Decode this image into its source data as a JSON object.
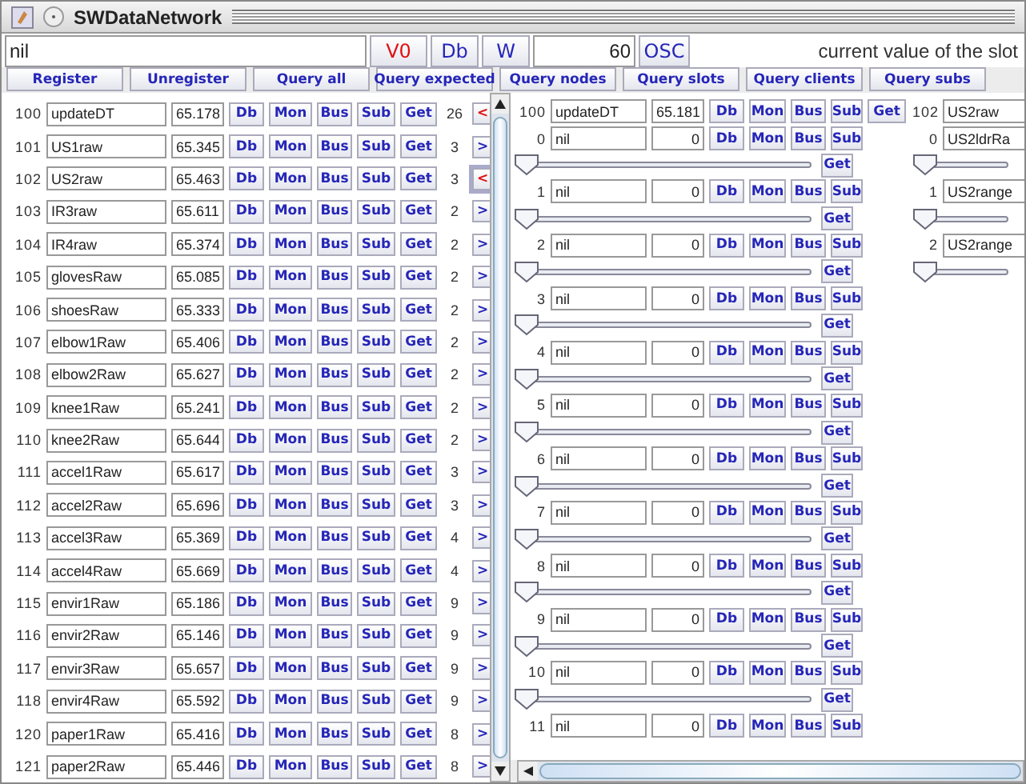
{
  "window": {
    "title": "SWDataNetwork"
  },
  "toolbar": {
    "input": "nil",
    "buttons": [
      {
        "label": "V0",
        "kind": "alert"
      },
      {
        "label": "Db",
        "kind": "normal"
      },
      {
        "label": "W",
        "kind": "normal"
      }
    ],
    "port": "60",
    "osc_button": "OSC",
    "status": "current value of the slot"
  },
  "queries": [
    "Register",
    "Unregister",
    "Query all",
    "Query expected",
    "Query nodes",
    "Query slots",
    "Query clients",
    "Query subs"
  ],
  "nodes": [
    {
      "id": "100",
      "name": "updateDT",
      "value": "65.178",
      "buttons": [
        "Db",
        "Mon",
        "Bus",
        "Sub",
        "Get"
      ],
      "count": "26",
      "arrow": "<",
      "kind": "back",
      "focused": false
    },
    {
      "id": "101",
      "name": "US1raw",
      "value": "65.345",
      "buttons": [
        "Db",
        "Mon",
        "Bus",
        "Sub",
        "Get"
      ],
      "count": "3",
      "arrow": ">",
      "kind": "forward",
      "focused": false
    },
    {
      "id": "102",
      "name": "US2raw",
      "value": "65.463",
      "buttons": [
        "Db",
        "Mon",
        "Bus",
        "Sub",
        "Get"
      ],
      "count": "3",
      "arrow": "<",
      "kind": "back",
      "focused": true
    },
    {
      "id": "103",
      "name": "IR3raw",
      "value": "65.611",
      "buttons": [
        "Db",
        "Mon",
        "Bus",
        "Sub",
        "Get"
      ],
      "count": "2",
      "arrow": ">",
      "kind": "forward",
      "focused": false
    },
    {
      "id": "104",
      "name": "IR4raw",
      "value": "65.374",
      "buttons": [
        "Db",
        "Mon",
        "Bus",
        "Sub",
        "Get"
      ],
      "count": "2",
      "arrow": ">",
      "kind": "forward",
      "focused": false
    },
    {
      "id": "105",
      "name": "glovesRaw",
      "value": "65.085",
      "buttons": [
        "Db",
        "Mon",
        "Bus",
        "Sub",
        "Get"
      ],
      "count": "2",
      "arrow": ">",
      "kind": "forward",
      "focused": false
    },
    {
      "id": "106",
      "name": "shoesRaw",
      "value": "65.333",
      "buttons": [
        "Db",
        "Mon",
        "Bus",
        "Sub",
        "Get"
      ],
      "count": "2",
      "arrow": ">",
      "kind": "forward",
      "focused": false
    },
    {
      "id": "107",
      "name": "elbow1Raw",
      "value": "65.406",
      "buttons": [
        "Db",
        "Mon",
        "Bus",
        "Sub",
        "Get"
      ],
      "count": "2",
      "arrow": ">",
      "kind": "forward",
      "focused": false
    },
    {
      "id": "108",
      "name": "elbow2Raw",
      "value": "65.627",
      "buttons": [
        "Db",
        "Mon",
        "Bus",
        "Sub",
        "Get"
      ],
      "count": "2",
      "arrow": ">",
      "kind": "forward",
      "focused": false
    },
    {
      "id": "109",
      "name": "knee1Raw",
      "value": "65.241",
      "buttons": [
        "Db",
        "Mon",
        "Bus",
        "Sub",
        "Get"
      ],
      "count": "2",
      "arrow": ">",
      "kind": "forward",
      "focused": false
    },
    {
      "id": "110",
      "name": "knee2Raw",
      "value": "65.644",
      "buttons": [
        "Db",
        "Mon",
        "Bus",
        "Sub",
        "Get"
      ],
      "count": "2",
      "arrow": ">",
      "kind": "forward",
      "focused": false
    },
    {
      "id": "111",
      "name": "accel1Raw",
      "value": "65.617",
      "buttons": [
        "Db",
        "Mon",
        "Bus",
        "Sub",
        "Get"
      ],
      "count": "3",
      "arrow": ">",
      "kind": "forward",
      "focused": false
    },
    {
      "id": "112",
      "name": "accel2Raw",
      "value": "65.696",
      "buttons": [
        "Db",
        "Mon",
        "Bus",
        "Sub",
        "Get"
      ],
      "count": "3",
      "arrow": ">",
      "kind": "forward",
      "focused": false
    },
    {
      "id": "113",
      "name": "accel3Raw",
      "value": "65.369",
      "buttons": [
        "Db",
        "Mon",
        "Bus",
        "Sub",
        "Get"
      ],
      "count": "4",
      "arrow": ">",
      "kind": "forward",
      "focused": false
    },
    {
      "id": "114",
      "name": "accel4Raw",
      "value": "65.669",
      "buttons": [
        "Db",
        "Mon",
        "Bus",
        "Sub",
        "Get"
      ],
      "count": "4",
      "arrow": ">",
      "kind": "forward",
      "focused": false
    },
    {
      "id": "115",
      "name": "envir1Raw",
      "value": "65.186",
      "buttons": [
        "Db",
        "Mon",
        "Bus",
        "Sub",
        "Get"
      ],
      "count": "9",
      "arrow": ">",
      "kind": "forward",
      "focused": false
    },
    {
      "id": "116",
      "name": "envir2Raw",
      "value": "65.146",
      "buttons": [
        "Db",
        "Mon",
        "Bus",
        "Sub",
        "Get"
      ],
      "count": "9",
      "arrow": ">",
      "kind": "forward",
      "focused": false
    },
    {
      "id": "117",
      "name": "envir3Raw",
      "value": "65.657",
      "buttons": [
        "Db",
        "Mon",
        "Bus",
        "Sub",
        "Get"
      ],
      "count": "9",
      "arrow": ">",
      "kind": "forward",
      "focused": false
    },
    {
      "id": "118",
      "name": "envir4Raw",
      "value": "65.592",
      "buttons": [
        "Db",
        "Mon",
        "Bus",
        "Sub",
        "Get"
      ],
      "count": "9",
      "arrow": ">",
      "kind": "forward",
      "focused": false
    },
    {
      "id": "120",
      "name": "paper1Raw",
      "value": "65.416",
      "buttons": [
        "Db",
        "Mon",
        "Bus",
        "Sub",
        "Get"
      ],
      "count": "8",
      "arrow": ">",
      "kind": "forward",
      "focused": false
    },
    {
      "id": "121",
      "name": "paper2Raw",
      "value": "65.446",
      "buttons": [
        "Db",
        "Mon",
        "Bus",
        "Sub",
        "Get"
      ],
      "count": "8",
      "arrow": ">",
      "kind": "forward",
      "focused": false
    }
  ],
  "detail": {
    "node": {
      "id": "100",
      "name": "updateDT",
      "value": "65.181",
      "buttons": [
        "Db",
        "Mon",
        "Bus",
        "Sub",
        "Get"
      ]
    },
    "slots": [
      {
        "index": "0",
        "name": "nil",
        "value": "0",
        "buttons": [
          "Db",
          "Mon",
          "Bus",
          "Sub"
        ],
        "get": "Get",
        "level": 0
      },
      {
        "index": "1",
        "name": "nil",
        "value": "0",
        "buttons": [
          "Db",
          "Mon",
          "Bus",
          "Sub"
        ],
        "get": "Get",
        "level": 0
      },
      {
        "index": "2",
        "name": "nil",
        "value": "0",
        "buttons": [
          "Db",
          "Mon",
          "Bus",
          "Sub"
        ],
        "get": "Get",
        "level": 0
      },
      {
        "index": "3",
        "name": "nil",
        "value": "0",
        "buttons": [
          "Db",
          "Mon",
          "Bus",
          "Sub"
        ],
        "get": "Get",
        "level": 0
      },
      {
        "index": "4",
        "name": "nil",
        "value": "0",
        "buttons": [
          "Db",
          "Mon",
          "Bus",
          "Sub"
        ],
        "get": "Get",
        "level": 0
      },
      {
        "index": "5",
        "name": "nil",
        "value": "0",
        "buttons": [
          "Db",
          "Mon",
          "Bus",
          "Sub"
        ],
        "get": "Get",
        "level": 0
      },
      {
        "index": "6",
        "name": "nil",
        "value": "0",
        "buttons": [
          "Db",
          "Mon",
          "Bus",
          "Sub"
        ],
        "get": "Get",
        "level": 0
      },
      {
        "index": "7",
        "name": "nil",
        "value": "0",
        "buttons": [
          "Db",
          "Mon",
          "Bus",
          "Sub"
        ],
        "get": "Get",
        "level": 0
      },
      {
        "index": "8",
        "name": "nil",
        "value": "0",
        "buttons": [
          "Db",
          "Mon",
          "Bus",
          "Sub"
        ],
        "get": "Get",
        "level": 0
      },
      {
        "index": "9",
        "name": "nil",
        "value": "0",
        "buttons": [
          "Db",
          "Mon",
          "Bus",
          "Sub"
        ],
        "get": "Get",
        "level": 0
      },
      {
        "index": "10",
        "name": "nil",
        "value": "0",
        "buttons": [
          "Db",
          "Mon",
          "Bus",
          "Sub"
        ],
        "get": "Get",
        "level": 0
      },
      {
        "index": "11",
        "name": "nil",
        "value": "0",
        "buttons": [
          "Db",
          "Mon",
          "Bus",
          "Sub"
        ]
      }
    ]
  },
  "second": {
    "node": {
      "id": "102",
      "name": "US2raw"
    },
    "slots": [
      {
        "index": "0",
        "name": "US2ldrRa",
        "level": 0
      },
      {
        "index": "1",
        "name": "US2range",
        "level": 0
      },
      {
        "index": "2",
        "name": "US2range",
        "level": 0
      }
    ]
  }
}
